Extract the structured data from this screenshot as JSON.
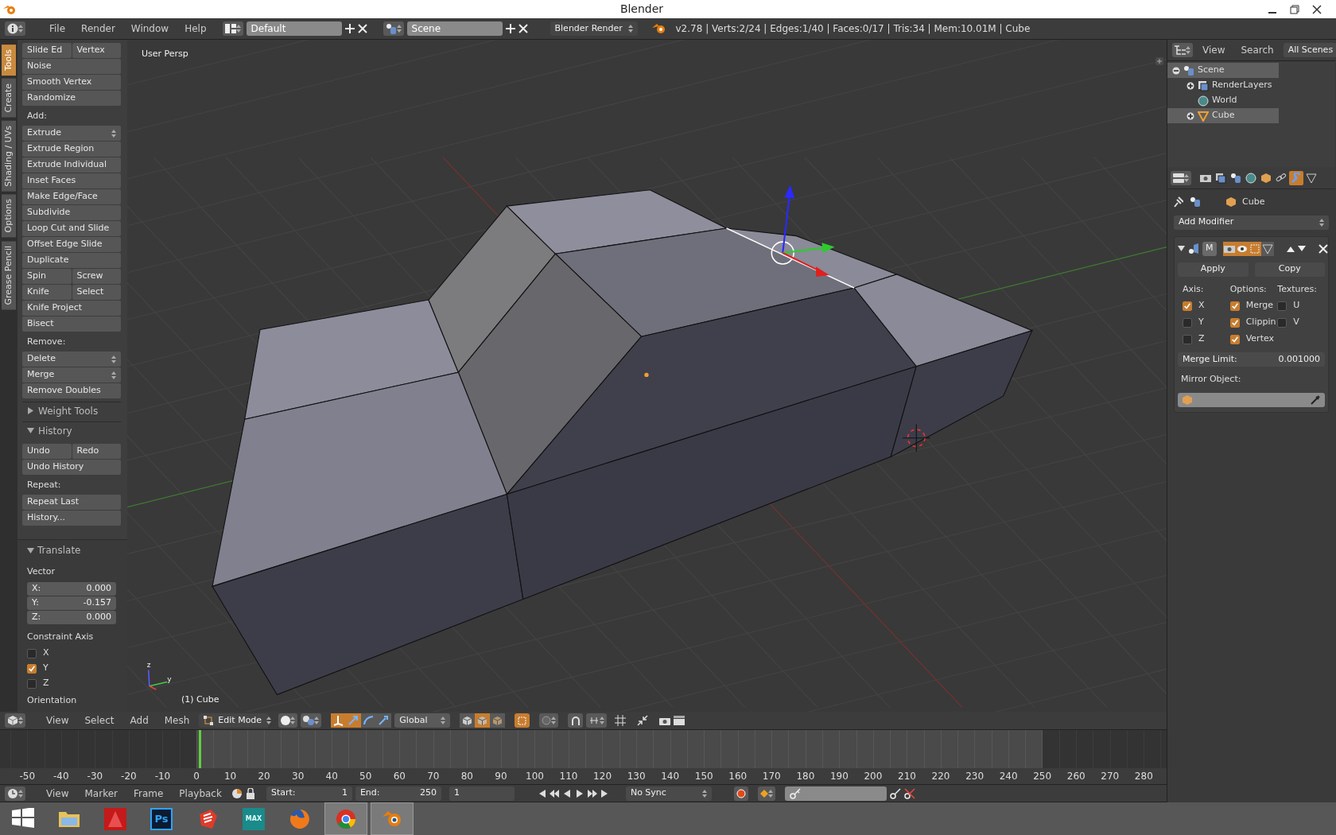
{
  "window": {
    "title": "Blender"
  },
  "info_header": {
    "menus": [
      "File",
      "Render",
      "Window",
      "Help"
    ],
    "layout": "Default",
    "scene": "Scene",
    "engine": "Blender Render",
    "stats": "v2.78 | Verts:2/24 | Edges:1/40 | Faces:0/17 | Tris:34 | Mem:10.01M | Cube"
  },
  "tool_tabs": [
    {
      "label": "Tools",
      "selected": true
    },
    {
      "label": "Create",
      "selected": false
    },
    {
      "label": "Shading / UVs",
      "selected": false
    },
    {
      "label": "Options",
      "selected": false
    },
    {
      "label": "Grease Pencil",
      "selected": false
    }
  ],
  "tool_shelf": [
    {
      "kind": "pair",
      "labels": [
        "Slide Ed",
        "Vertex"
      ]
    },
    {
      "kind": "button",
      "label": "Noise"
    },
    {
      "kind": "button",
      "label": "Smooth Vertex"
    },
    {
      "kind": "button",
      "label": "Randomize"
    },
    {
      "kind": "heading",
      "label": "Add:"
    },
    {
      "kind": "dropdown",
      "label": "Extrude"
    },
    {
      "kind": "button",
      "label": "Extrude Region"
    },
    {
      "kind": "button",
      "label": "Extrude Individual"
    },
    {
      "kind": "button",
      "label": "Inset Faces"
    },
    {
      "kind": "button",
      "label": "Make Edge/Face"
    },
    {
      "kind": "button",
      "label": "Subdivide"
    },
    {
      "kind": "button",
      "label": "Loop Cut and Slide"
    },
    {
      "kind": "button",
      "label": "Offset Edge Slide"
    },
    {
      "kind": "button",
      "label": "Duplicate"
    },
    {
      "kind": "pair",
      "labels": [
        "Spin",
        "Screw"
      ]
    },
    {
      "kind": "pair",
      "labels": [
        "Knife",
        "Select"
      ]
    },
    {
      "kind": "button",
      "label": "Knife Project"
    },
    {
      "kind": "button",
      "label": "Bisect"
    },
    {
      "kind": "heading",
      "label": "Remove:"
    },
    {
      "kind": "dropdown",
      "label": "Delete"
    },
    {
      "kind": "dropdown",
      "label": "Merge"
    },
    {
      "kind": "button",
      "label": "Remove Doubles"
    },
    {
      "kind": "panel",
      "label": "Weight Tools",
      "expanded": false
    },
    {
      "kind": "panel",
      "label": "History",
      "expanded": true
    },
    {
      "kind": "pair",
      "labels": [
        "Undo",
        "Redo"
      ]
    },
    {
      "kind": "button",
      "label": "Undo History"
    },
    {
      "kind": "heading",
      "label": "Repeat:"
    },
    {
      "kind": "button",
      "label": "Repeat Last"
    },
    {
      "kind": "button",
      "label": "History..."
    }
  ],
  "operator_panel": {
    "title": "Translate",
    "expanded": true,
    "vector_label": "Vector",
    "fields": [
      {
        "label": "X:",
        "value": "0.000"
      },
      {
        "label": "Y:",
        "value": "-0.157"
      },
      {
        "label": "Z:",
        "value": "0.000"
      }
    ],
    "constraint_label": "Constraint Axis",
    "axes": [
      {
        "label": "X",
        "checked": false
      },
      {
        "label": "Y",
        "checked": true
      },
      {
        "label": "Z",
        "checked": false
      }
    ],
    "next_label": "Orientation"
  },
  "viewport": {
    "view_label": "User Persp",
    "object_label": "(1) Cube",
    "axis_labels": [
      "z",
      "y"
    ]
  },
  "viewport_header": {
    "menus": [
      "View",
      "Select",
      "Add",
      "Mesh"
    ],
    "mode": "Edit Mode",
    "orientation": "Global",
    "manipulators": [
      {
        "kind": "manipulator",
        "selected": true
      },
      {
        "kind": "translate",
        "selected": true
      },
      {
        "kind": "rotate",
        "selected": false
      },
      {
        "kind": "scale",
        "selected": false
      }
    ],
    "select_modes": [
      {
        "kind": "vertex",
        "selected": false
      },
      {
        "kind": "edge",
        "selected": true
      },
      {
        "kind": "face",
        "selected": false
      }
    ],
    "occlude_on": true
  },
  "timeline": {
    "ticks": [
      "-50",
      "-40",
      "-30",
      "-20",
      "-10",
      "0",
      "10",
      "20",
      "30",
      "40",
      "50",
      "60",
      "70",
      "80",
      "90",
      "100",
      "110",
      "120",
      "130",
      "140",
      "150",
      "160",
      "170",
      "180",
      "190",
      "200",
      "210",
      "220",
      "230",
      "240",
      "250",
      "260",
      "270",
      "280"
    ]
  },
  "timeline_header": {
    "menus": [
      "View",
      "Marker",
      "Frame",
      "Playback"
    ],
    "start_label": "Start:",
    "start": "1",
    "end_label": "End:",
    "end": "250",
    "frame": "1",
    "sync": "No Sync"
  },
  "outliner": {
    "menus": [
      "View",
      "Search"
    ],
    "filter": "All Scenes",
    "tree": [
      {
        "label": "Scene",
        "kind": "scene",
        "selected": true,
        "expanded": true,
        "children": [
          {
            "label": "RenderLayers",
            "kind": "renderlayers",
            "selected": false,
            "expanded": false
          },
          {
            "label": "World",
            "kind": "world",
            "selected": false
          },
          {
            "label": "Cube",
            "kind": "object",
            "selected": true,
            "expanded": false
          }
        ]
      }
    ]
  },
  "properties": {
    "tabs": [
      {
        "kind": "render",
        "selected": false
      },
      {
        "kind": "layers",
        "selected": false
      },
      {
        "kind": "scene",
        "selected": false
      },
      {
        "kind": "world",
        "selected": false
      },
      {
        "kind": "object",
        "selected": false
      },
      {
        "kind": "constraints",
        "selected": false
      },
      {
        "kind": "modifiers",
        "selected": true
      },
      {
        "kind": "data",
        "selected": false
      }
    ],
    "object": "Cube",
    "add_modifier": "Add Modifier",
    "modifier": {
      "name": "M",
      "expanded": true,
      "buttons": [
        "Apply",
        "Copy"
      ],
      "columns": [
        {
          "heading": "Axis:",
          "options": [
            {
              "label": "X",
              "checked": true
            },
            {
              "label": "Y",
              "checked": false
            },
            {
              "label": "Z",
              "checked": false
            }
          ]
        },
        {
          "heading": "Options:",
          "options": [
            {
              "label": "Merge",
              "checked": true
            },
            {
              "label": "Clippin",
              "checked": true
            },
            {
              "label": "Vertex",
              "checked": true
            }
          ]
        },
        {
          "heading": "Textures:",
          "options": [
            {
              "label": "U",
              "checked": false
            },
            {
              "label": "V",
              "checked": false
            }
          ]
        }
      ],
      "merge_label": "Merge Limit:",
      "merge_value": "0.001000",
      "mirror_label": "Mirror Object:"
    }
  },
  "taskbar": [
    {
      "kind": "start",
      "selected": false
    },
    {
      "kind": "folder",
      "selected": false
    },
    {
      "kind": "autocad",
      "selected": false
    },
    {
      "kind": "photoshop",
      "label": "Ps",
      "selected": false
    },
    {
      "kind": "sketchup",
      "selected": false
    },
    {
      "kind": "max",
      "label": "MAX",
      "selected": false
    },
    {
      "kind": "firefox",
      "selected": false
    },
    {
      "kind": "chrome",
      "selected": true
    },
    {
      "kind": "blender",
      "selected": true
    }
  ]
}
